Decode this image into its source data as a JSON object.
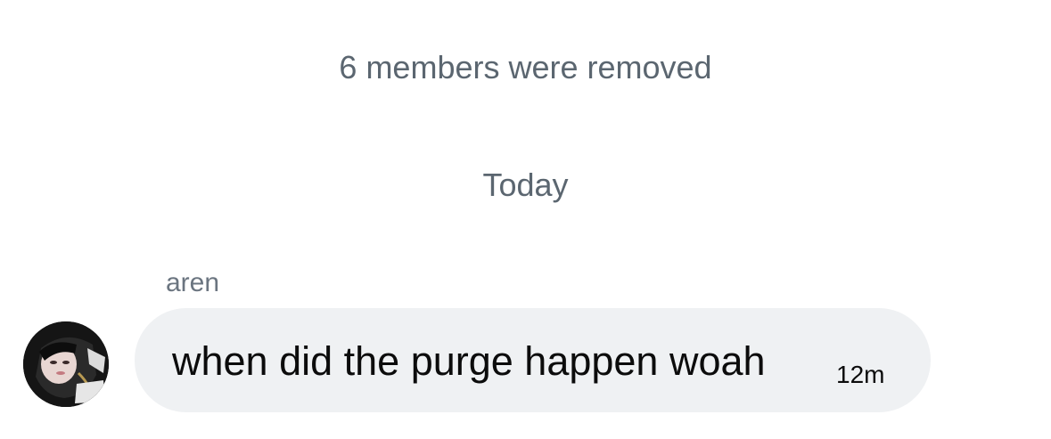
{
  "system": {
    "removed_notice": "6 members were removed",
    "date_divider": "Today"
  },
  "message": {
    "sender": "aren",
    "text": "when did the purge happen woah",
    "time": "12m",
    "avatar_icon": "user-photo-avatar"
  },
  "colors": {
    "bubble": "#eff1f3",
    "system_text": "#5b6670",
    "message_text": "#0c0c0c"
  }
}
